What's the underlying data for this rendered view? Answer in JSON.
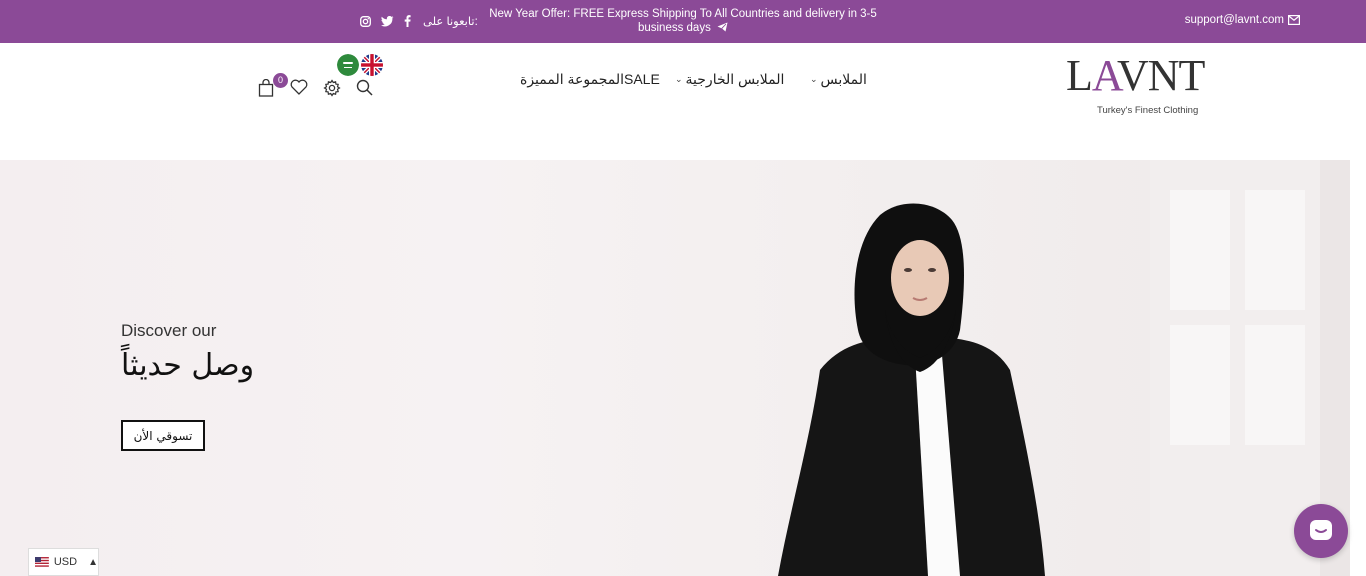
{
  "topbar": {
    "email": "support@lavnt.com",
    "offer": "New Year Offer: FREE Express Shipping To All Countries and delivery in 3-5 business days",
    "follow_label": "تابعونا على:",
    "icons": [
      "envelope-icon",
      "telegram-icon",
      "facebook-icon",
      "twitter-icon",
      "instagram-icon"
    ],
    "bg_color": "#8b4a97"
  },
  "header": {
    "logo_text": "LAVNT",
    "logo_tagline": "Turkey's Finest Clothing",
    "nav": [
      {
        "label": "الملابس",
        "has_dropdown": true
      },
      {
        "label": "الملابس الخارجية",
        "has_dropdown": true
      },
      {
        "label": "المجموعة المميزةSALE",
        "has_dropdown": false
      }
    ],
    "languages": [
      "ar",
      "en"
    ],
    "cart_count": "0",
    "tool_icons": [
      "search-icon",
      "gear-icon",
      "heart-icon",
      "bag-icon"
    ]
  },
  "hero": {
    "subtitle": "Discover our",
    "title": "وصل حديثاً",
    "cta_label": "تسوقي الأن"
  },
  "currency": {
    "code": "USD"
  },
  "chat": {
    "icon": "chat-icon",
    "color": "#8b4a97"
  }
}
